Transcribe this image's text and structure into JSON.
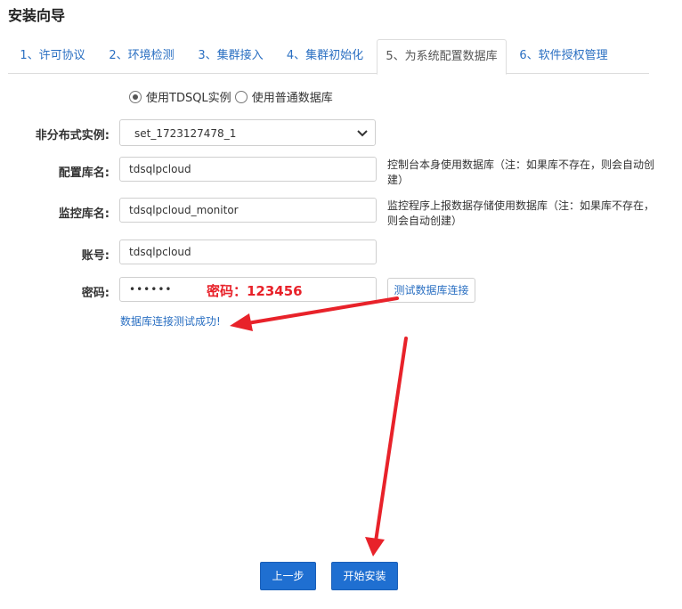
{
  "page_title": "安装向导",
  "tabs": [
    {
      "label": "1、许可协议",
      "active": false
    },
    {
      "label": "2、环境检测",
      "active": false
    },
    {
      "label": "3、集群接入",
      "active": false
    },
    {
      "label": "4、集群初始化",
      "active": false
    },
    {
      "label": "5、为系统配置数据库",
      "active": true
    },
    {
      "label": "6、软件授权管理",
      "active": false
    }
  ],
  "db_type": {
    "options": [
      "使用TDSQL实例",
      "使用普通数据库"
    ],
    "selected": "使用TDSQL实例"
  },
  "form": {
    "instance": {
      "label": "非分布式实例:",
      "value": "set_1723127478_1"
    },
    "config_db": {
      "label": "配置库名:",
      "value": "tdsqlpcloud",
      "hint": "控制台本身使用数据库（注：如果库不存在，则会自动创建）"
    },
    "monitor_db": {
      "label": "监控库名:",
      "value": "tdsqlpcloud_monitor",
      "hint": "监控程序上报数据存储使用数据库（注：如果库不存在，则会自动创建）"
    },
    "account": {
      "label": "账号:",
      "value": "tdsqlpcloud"
    },
    "password": {
      "label": "密码:",
      "value": "••••••"
    }
  },
  "test_button_label": "测试数据库连接",
  "success_message": "数据库连接测试成功!",
  "annotation_text": "密码：123456",
  "buttons": {
    "prev": "上一步",
    "install": "开始安装"
  },
  "colors": {
    "accent": "#1f6fd1",
    "link": "#2a6fc2",
    "annotation": "#e8222a"
  }
}
